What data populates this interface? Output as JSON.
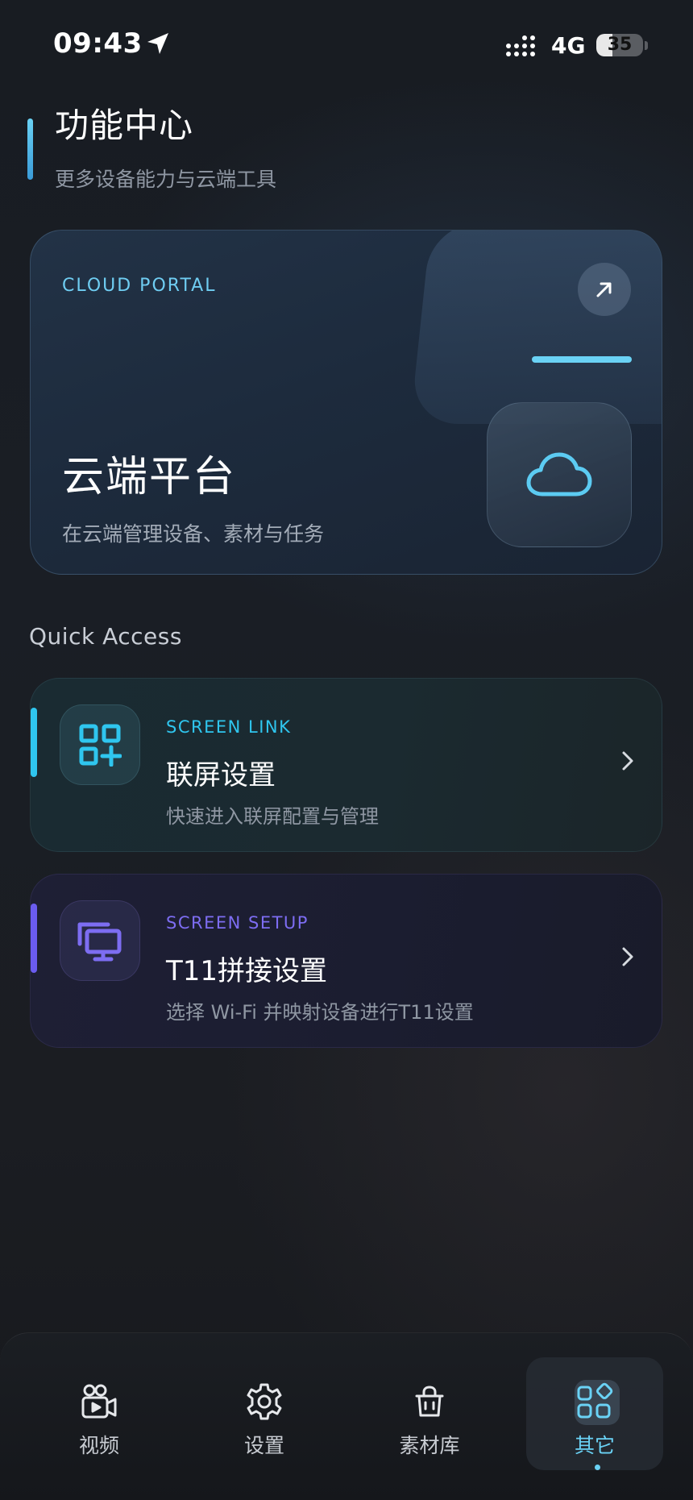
{
  "status_bar": {
    "time": "09:43",
    "network": "4G",
    "battery_level": "35",
    "battery_fraction": 0.35
  },
  "header": {
    "title": "功能中心",
    "subtitle": "更多设备能力与云端工具"
  },
  "cloud_card": {
    "eyebrow": "CLOUD PORTAL",
    "title": "云端平台",
    "description": "在云端管理设备、素材与任务",
    "icon": "cloud-icon",
    "action_icon": "arrow-up-right-icon"
  },
  "quick_access": {
    "title": "Quick Access",
    "items": [
      {
        "eyebrow": "SCREEN LINK",
        "title": "联屏设置",
        "description": "快速进入联屏配置与管理",
        "icon": "qr-grid-plus-icon",
        "accent": "#2fc6ef"
      },
      {
        "eyebrow": "SCREEN SETUP",
        "title": "T11拼接设置",
        "description": "选择 Wi-Fi 并映射设备进行T11设置",
        "icon": "monitors-icon",
        "accent": "#6b5cf0"
      }
    ]
  },
  "bottom_nav": {
    "active_index": 3,
    "accent": "#6ad2f5",
    "items": [
      {
        "label": "视频",
        "icon": "video-camera-icon"
      },
      {
        "label": "设置",
        "icon": "gear-icon"
      },
      {
        "label": "素材库",
        "icon": "shopping-bag-icon"
      },
      {
        "label": "其它",
        "icon": "apps-grid-icon"
      }
    ]
  }
}
